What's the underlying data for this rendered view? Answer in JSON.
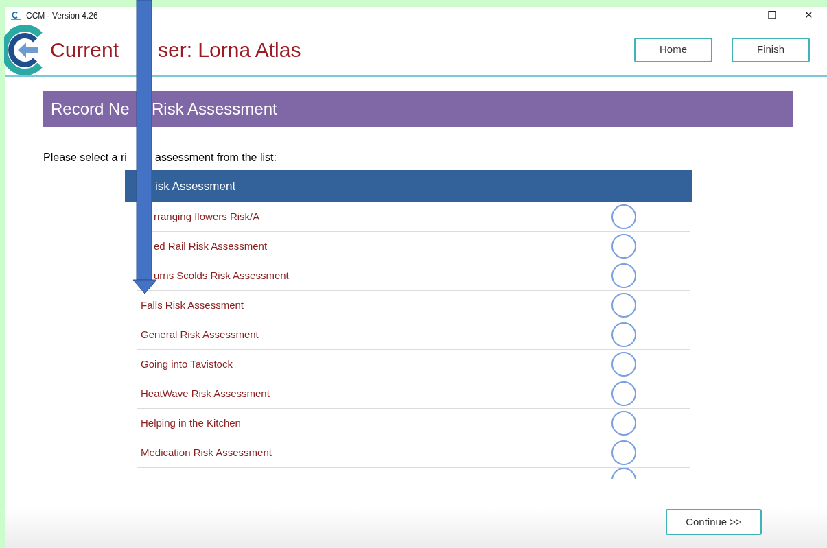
{
  "window": {
    "title": "CCM - Version 4.26",
    "controls": [
      "–",
      "☐",
      "✕"
    ]
  },
  "header": {
    "user_title": {
      "before": "Current",
      "after": "ser: Lorna Atlas"
    },
    "buttons": [
      "Home",
      "Finish"
    ]
  },
  "banner": {
    "before": "Record Ne",
    "after": "Risk Assessment"
  },
  "prompt": {
    "before": "Please select a ri",
    "after": "assessment from the list:"
  },
  "table": {
    "column": "isk Assessment",
    "rows": [
      {
        "kind": "clipped",
        "label": "rranging flowers Risk/A",
        "selected": false
      },
      {
        "kind": "clipped",
        "label": "ed Rail Risk Assessment",
        "selected": false
      },
      {
        "kind": "clipped",
        "label": "urns Scolds Risk Assessment",
        "selected": false
      },
      {
        "kind": "full",
        "label": "Falls Risk Assessment",
        "selected": false
      },
      {
        "kind": "full",
        "label": "General Risk Assessment",
        "selected": false
      },
      {
        "kind": "full",
        "label": "Going into Tavistock",
        "selected": false
      },
      {
        "kind": "full",
        "label": "HeatWave Risk Assessment",
        "selected": false
      },
      {
        "kind": "full",
        "label": "Helping in the Kitchen",
        "selected": false
      },
      {
        "kind": "full",
        "label": "Medication Risk Assessment",
        "selected": false
      },
      {
        "kind": "hidden",
        "selected": false
      }
    ]
  },
  "continue_button": "Continue >>"
}
